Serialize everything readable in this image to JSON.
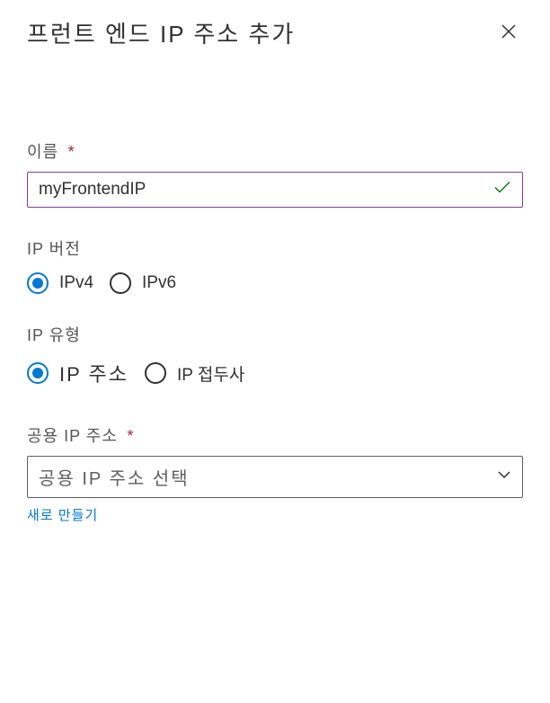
{
  "header": {
    "title": "프런트 엔드 IP 주소 추가"
  },
  "form": {
    "name": {
      "label": "이름",
      "value": "myFrontendIP",
      "required": true
    },
    "ipVersion": {
      "label": "IP 버전",
      "options": [
        {
          "label": "IPv4",
          "selected": true
        },
        {
          "label": "IPv6",
          "selected": false
        }
      ]
    },
    "ipType": {
      "label": "IP 유형",
      "options": [
        {
          "label": "IP 주소",
          "selected": true
        },
        {
          "label": "IP 접두사",
          "selected": false
        }
      ]
    },
    "publicIp": {
      "label": "공용 IP 주소",
      "required": true,
      "placeholder": "공용 IP 주소 선택",
      "createNewLabel": "새로 만들기"
    }
  }
}
